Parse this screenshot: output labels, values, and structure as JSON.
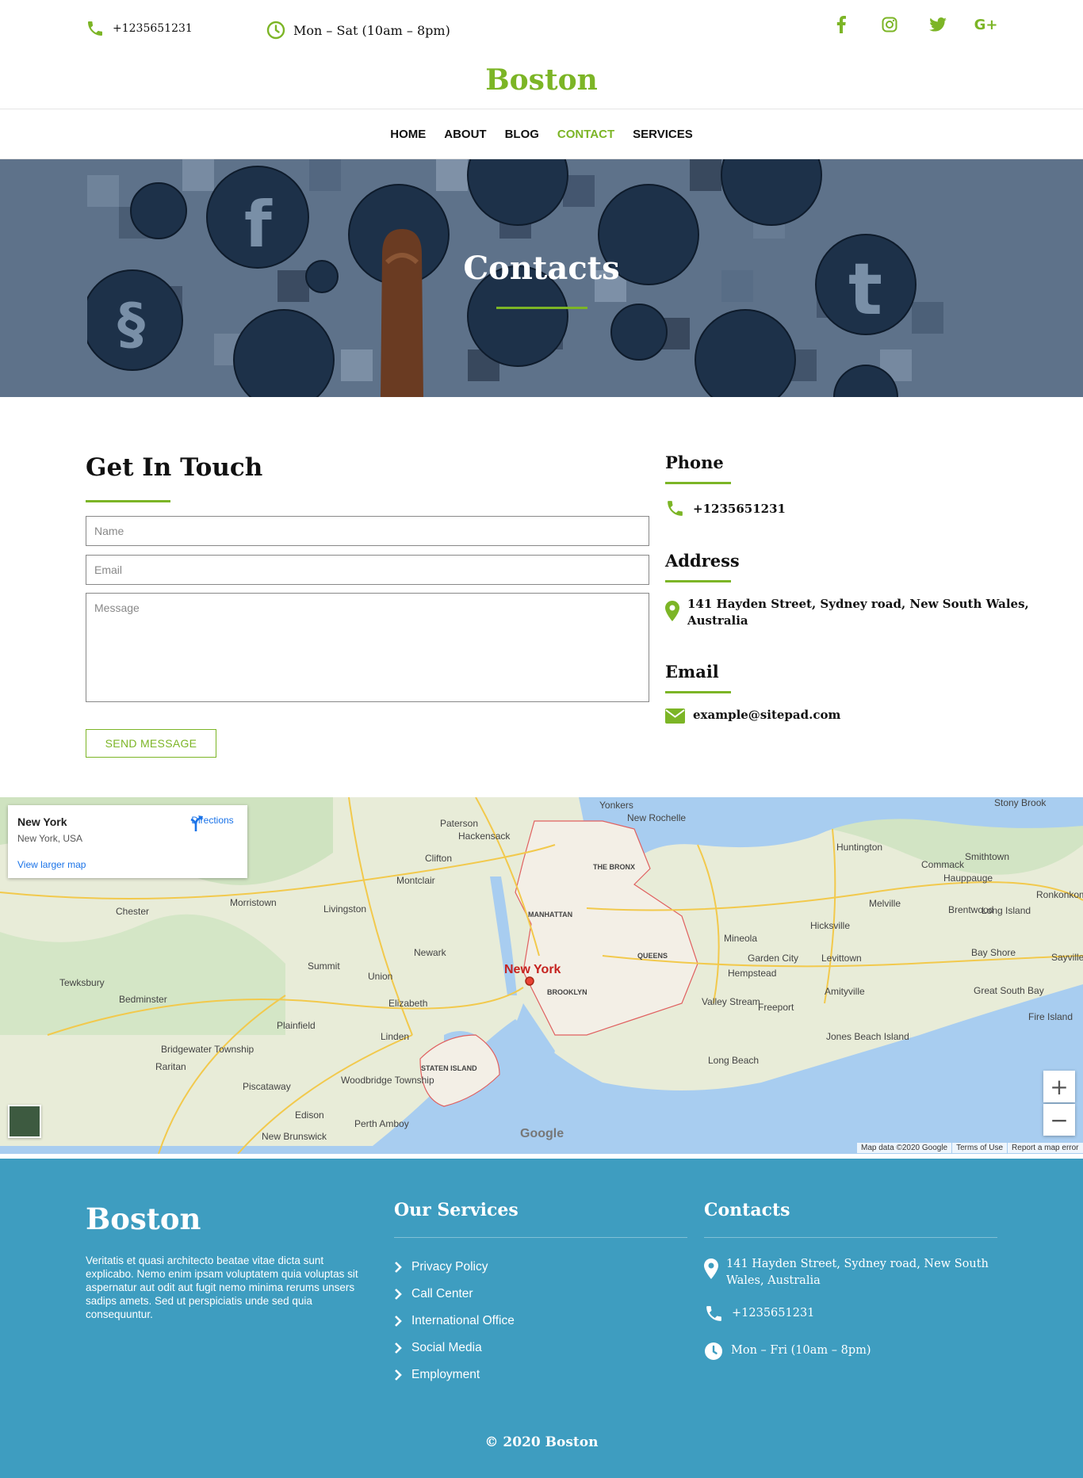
{
  "topbar": {
    "phone": "+1235651231",
    "hours": "Mon – Sat (10am – 8pm)",
    "socials": [
      {
        "icon": "facebook-icon",
        "glyph": "f"
      },
      {
        "icon": "instagram-icon",
        "glyph": "◎"
      },
      {
        "icon": "twitter-icon",
        "glyph": "🐦"
      },
      {
        "icon": "google-plus-icon",
        "glyph": "G+"
      }
    ]
  },
  "brand": "Boston",
  "nav": [
    {
      "label": "HOME",
      "active": false
    },
    {
      "label": "ABOUT",
      "active": false
    },
    {
      "label": "BLOG",
      "active": false
    },
    {
      "label": "CONTACT",
      "active": true
    },
    {
      "label": "SERVICES",
      "active": false
    }
  ],
  "hero": {
    "title": "Contacts"
  },
  "contact_form": {
    "title": "Get In Touch",
    "name_placeholder": "Name",
    "email_placeholder": "Email",
    "message_placeholder": "Message",
    "send_label": "SEND MESSAGE"
  },
  "contact_info": {
    "phone_heading": "Phone",
    "phone": "+1235651231",
    "address_heading": "Address",
    "address_line1": "141 Hayden Street, Sydney road, New South Wales,",
    "address_line2": "Australia",
    "email_heading": "Email",
    "email": "example@sitepad.com"
  },
  "map": {
    "place_title": "New York",
    "place_subtitle": "New York, USA",
    "directions_label": "Directions",
    "larger_map_label": "View larger map",
    "center_label": "New York",
    "labels": [
      "Yonkers",
      "New Rochelle",
      "Paterson",
      "Hackensack",
      "Clifton",
      "THE BRONX",
      "MANHATTAN",
      "QUEENS",
      "BROOKLYN",
      "Newark",
      "Union",
      "Elizabeth",
      "Linden",
      "STATEN ISLAND",
      "Hempstead",
      "Long Beach",
      "Freeport",
      "Huntington",
      "Jones Beach Island",
      "Long Island",
      "Edison",
      "Woodbridge Township",
      "Perth Amboy",
      "Plainfield",
      "Chester",
      "Bedminster",
      "Tewksbury",
      "Bridgewater Township",
      "Raritan",
      "New Brunswick",
      "Piscataway",
      "Summit",
      "Livingston",
      "Morristown",
      "Montclair",
      "Mineola",
      "Garden City",
      "Valley Stream",
      "Levittown",
      "Hicksville",
      "Melville",
      "Amityville",
      "Commack",
      "Smithtown",
      "Brentwood",
      "Bay Shore",
      "Fire Island",
      "Great South Bay",
      "Stony Brook",
      "Sayville",
      "Ronkonkoma",
      "Hauppauge"
    ],
    "logo": "Google",
    "attribution": [
      "Map data ©2020 Google",
      "Terms of Use",
      "Report a map error"
    ],
    "zoom_in": "+",
    "zoom_out": "−"
  },
  "footer": {
    "brand": "Boston",
    "description": "Veritatis et quasi architecto beatae vitae dicta sunt explicabo. Nemo enim ipsam voluptatem quia voluptas sit aspernatur aut odit aut fugit nemo minima rerums unsers sadips amets. Sed ut perspiciatis unde sed quia consequuntur.",
    "services_heading": "Our Services",
    "services": [
      "Privacy Policy",
      "Call Center",
      "International Office",
      "Social Media",
      "Employment"
    ],
    "contacts_heading": "Contacts",
    "address_line1": "141 Hayden Street, Sydney road, New South",
    "address_line2": "Wales, Australia",
    "phone": "+1235651231",
    "hours": "Mon – Fri (10am – 8pm)",
    "copyright": "© 2020 Boston"
  },
  "colors": {
    "accent": "#7cb526",
    "footer_bg": "#3e9dc0",
    "hero_bg": "#5e728a"
  }
}
